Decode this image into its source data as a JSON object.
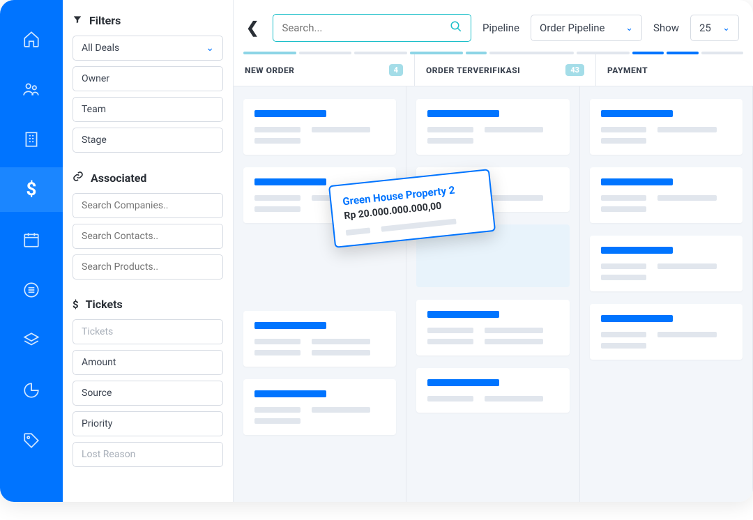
{
  "nav": {
    "items": [
      {
        "name": "home-icon"
      },
      {
        "name": "users-icon"
      },
      {
        "name": "building-icon"
      },
      {
        "name": "dollar-icon",
        "active": true
      },
      {
        "name": "calendar-icon"
      },
      {
        "name": "list-icon"
      },
      {
        "name": "layers-icon"
      },
      {
        "name": "pie-icon"
      },
      {
        "name": "tag-icon"
      }
    ]
  },
  "filters": {
    "title": "Filters",
    "deals_select": "All Deals",
    "fields": [
      "Owner",
      "Team",
      "Stage"
    ],
    "associated_title": "Associated",
    "associated": [
      {
        "placeholder": "Search Companies.."
      },
      {
        "placeholder": "Search Contacts.."
      },
      {
        "placeholder": "Search Products.."
      }
    ],
    "tickets_title": "Tickets",
    "tickets_fields": [
      "Tickets",
      "Amount",
      "Source",
      "Priority",
      "Lost Reason"
    ]
  },
  "topbar": {
    "search_placeholder": "Search...",
    "pipeline_label": "Pipeline",
    "pipeline_value": "Order Pipeline",
    "show_label": "Show",
    "show_value": "25"
  },
  "columns": [
    {
      "label": "NEW ORDER",
      "count": "4"
    },
    {
      "label": "ORDER TERVERIFIKASI",
      "count": "43"
    },
    {
      "label": "PAYMENT",
      "count": ""
    }
  ],
  "drag_card": {
    "title": "Green House Property 2",
    "price": "Rp 20.000.000.000,00"
  }
}
